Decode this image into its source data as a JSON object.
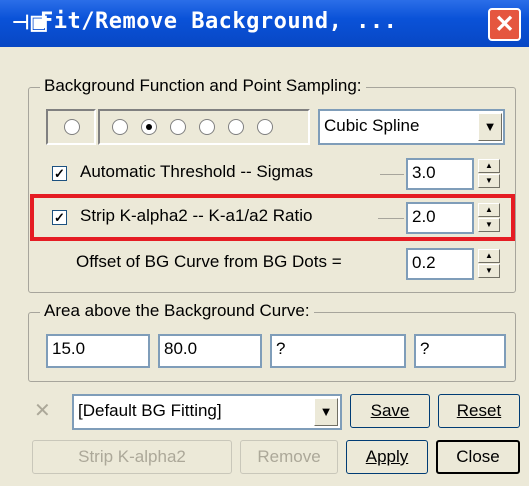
{
  "window": {
    "title": "Fit/Remove Background, ...",
    "title_icon": "pin-icon",
    "close_glyph": "✕"
  },
  "bg_group": {
    "legend": "Background Function and Point Sampling:",
    "radio_count": 7,
    "selected_radio_index": 2,
    "function_select": "Cubic Spline",
    "auto_threshold": {
      "checked": true,
      "label": "Automatic Threshold -- Sigmas",
      "value": "3.0"
    },
    "strip_k": {
      "checked": true,
      "label": "Strip K-alpha2 -- K-a1/a2 Ratio",
      "value": "2.0"
    },
    "offset": {
      "label": "Offset of BG Curve from BG Dots =",
      "value": "0.2"
    }
  },
  "area_group": {
    "legend": "Area above the Background Curve:",
    "fields": [
      "15.0",
      "80.0",
      "?",
      "?"
    ]
  },
  "bottom": {
    "x_glyph": "✕",
    "preset_select": "[Default BG Fitting]",
    "save_label": "Save",
    "reset_label": "Reset",
    "strip_label": "Strip K-alpha2",
    "remove_label": "Remove",
    "apply_label": "Apply",
    "close_label": "Close"
  },
  "colors": {
    "highlight": "#e51c23",
    "titlebar": "#0a52d8"
  }
}
